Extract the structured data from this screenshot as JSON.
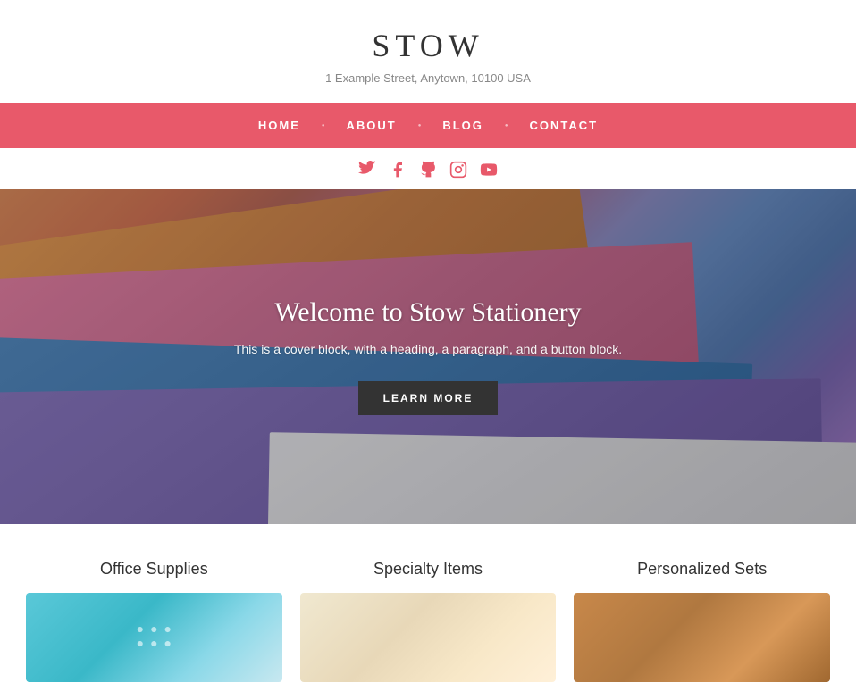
{
  "site": {
    "title": "STOW",
    "address": "1 Example Street, Anytown, 10100 USA"
  },
  "nav": {
    "items": [
      {
        "label": "HOME",
        "href": "#"
      },
      {
        "label": "ABOUT",
        "href": "#"
      },
      {
        "label": "BLOG",
        "href": "#"
      },
      {
        "label": "CONTACT",
        "href": "#"
      }
    ]
  },
  "social": {
    "links": [
      {
        "name": "twitter",
        "title": "Twitter"
      },
      {
        "name": "facebook",
        "title": "Facebook"
      },
      {
        "name": "github",
        "title": "GitHub"
      },
      {
        "name": "instagram",
        "title": "Instagram"
      },
      {
        "name": "youtube",
        "title": "YouTube"
      }
    ]
  },
  "hero": {
    "title": "Welcome to Stow Stationery",
    "subtitle": "This is a cover block, with a heading, a paragraph, and a button block.",
    "button_label": "LEARN MORE"
  },
  "categories": {
    "items": [
      {
        "label": "Office Supplies"
      },
      {
        "label": "Specialty Items"
      },
      {
        "label": "Personalized Sets"
      }
    ]
  }
}
